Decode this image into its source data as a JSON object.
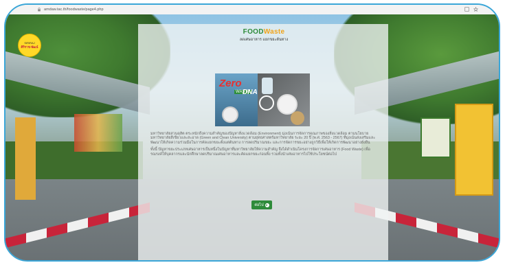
{
  "browser": {
    "url": "amdaw.tac.th/foodwaste/page4.php"
  },
  "header": {
    "logo_top": "SIRIRAJ",
    "logo_bottom": "ศิริราช-พัฒน์",
    "brand_food": "FOOD",
    "brand_waste": "Waste",
    "brand_sub": "ลดเศษอาหาร แยกขยะต้นทาง"
  },
  "hero": {
    "zero": "Zero",
    "waste": "WASTE",
    "dna": "DNA"
  },
  "content": {
    "paragraph1": "มหาวิทยาลัยสวนดุสิต ตระหนักถึงความสำคัญของปัญหาสิ่งแวดล้อม (Environment) มุ่งเน้นการจัดการคุณภาพของสิ่งแวดล้อม ตามนโยบายมหาวิทยาลัยสีเขียวและสะอาด (Green and Clean University) ตามยุทธศาสตร์มหาวิทยาลัย ระยะ 20 ปี (พ.ศ. 2563 - 2567) ที่มุ่งเน้นส่งเสริมและพัฒนาให้เกิดความร่วมมือในการคัดแยกขยะตั้งแต่ต้นทาง การลดปริมาณขยะ และการจัดการขยะอย่างถูกวิธีเพื่อให้เกิดการพัฒนาอย่างยั่งยืน",
    "paragraph2": "ทั้งนี้ ปัญหาขยะประเภทเศษอาหารเป็นหนึ่งในปัญหาที่มหาวิทยาลัยให้ความสำคัญ จึงได้ดำเนินโครงการจัดการเศษอาหาร (Food Waste) เพื่อรณรงค์ให้บุคลากรและนักศึกษาลดปริมาณเศษอาหารและคัดแยกขยะก่อนทิ้ง รวมทั้งนำเศษอาหารไปใช้ประโยชน์ต่อไป",
    "next_label": "ต่อไป"
  }
}
